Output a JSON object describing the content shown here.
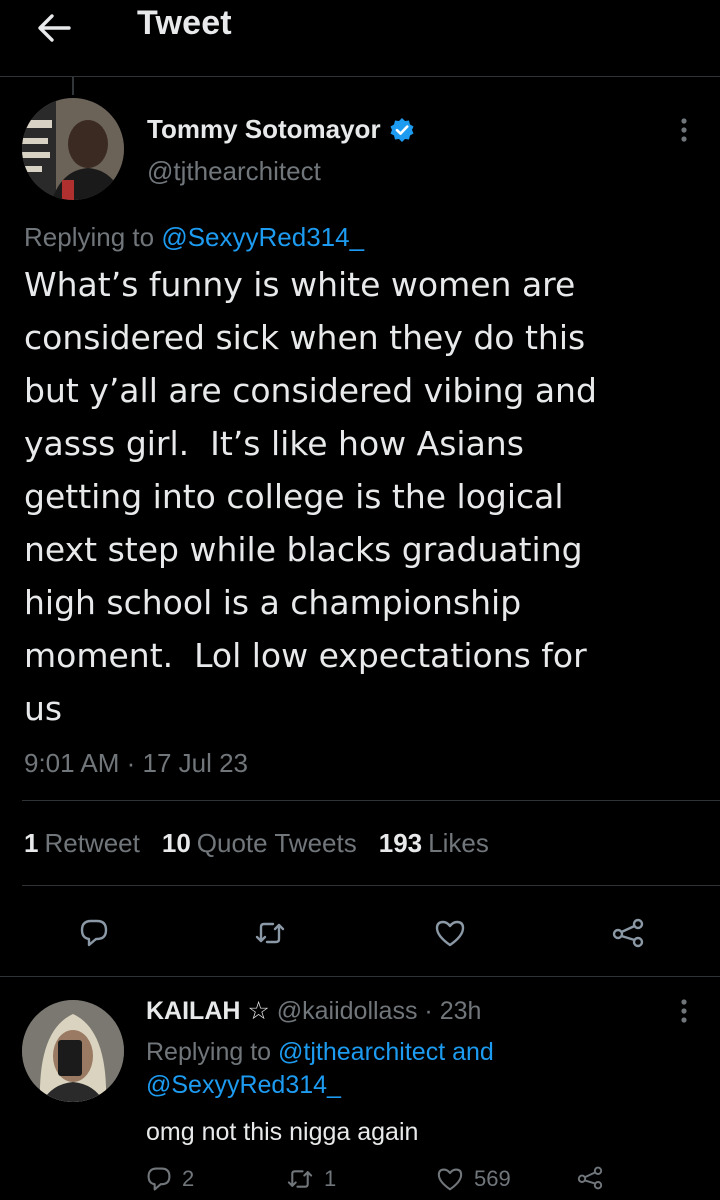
{
  "header": {
    "title": "Tweet",
    "back_icon": "arrow-left-icon"
  },
  "tweet": {
    "author_name": "Tommy Sotomayor",
    "verified": true,
    "handle": "@tjthearchitect",
    "replying_prefix": "Replying to ",
    "replying_to": "@SexyyRed314_",
    "text": "What’s funny is white women are\nconsidered sick when they do this\nbut y’all are considered vibing and\nyasss girl.  It’s like how Asians\ngetting into college is the logical\nnext step while blacks graduating\nhigh school is a championship\nmoment.  Lol low expectations for\nus",
    "timestamp": "9:01 AM · 17 Jul 23",
    "stats": {
      "retweets_count": "1",
      "retweets_label": "Retweet",
      "quotes_count": "10",
      "quotes_label": "Quote Tweets",
      "likes_count": "193",
      "likes_label": "Likes"
    },
    "action_icons": [
      "reply-icon",
      "retweet-icon",
      "like-icon",
      "share-icon"
    ]
  },
  "reply": {
    "author_name": "KAILAH ☆",
    "handle": "@kaiidollass",
    "time": "23h",
    "replying_prefix": "Replying to ",
    "replying_to_1": "@tjthearchitect",
    "replying_and": " and ",
    "replying_to_2": "@SexyyRed314_",
    "text": "omg not this nigga again",
    "reply_count": "2",
    "retweet_count": "1",
    "like_count": "569"
  },
  "colors": {
    "background": "#000000",
    "text_primary": "#e7e9ea",
    "text_secondary": "#71767b",
    "accent": "#1d9bf0",
    "divider": "#2f3336"
  }
}
